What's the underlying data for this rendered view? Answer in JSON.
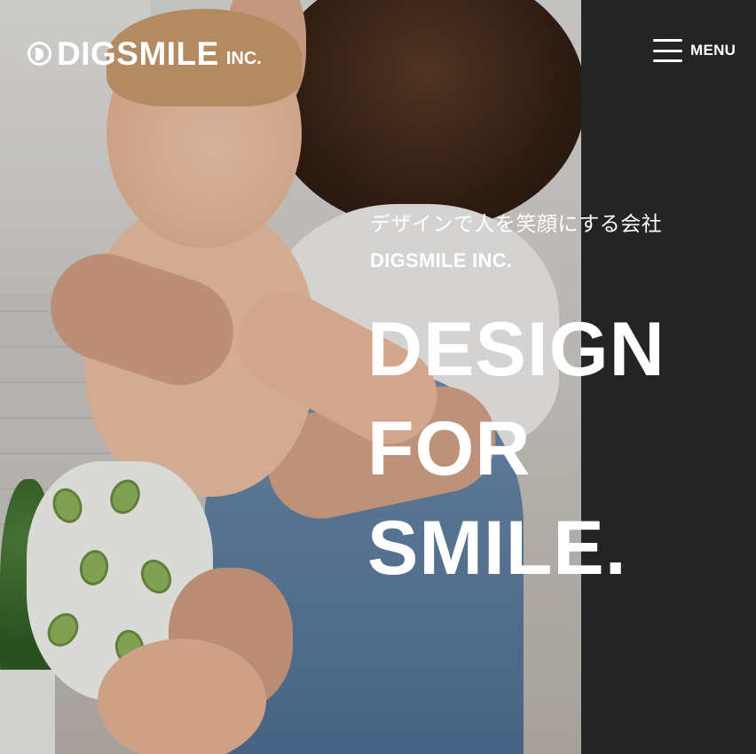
{
  "header": {
    "logo_text": "DIGSMILE",
    "logo_sub": "INC.",
    "menu_label": "MENU"
  },
  "hero": {
    "tagline_jp": "デザインで人を笑顔にする会社",
    "tagline_en": "DIGSMILE INC.",
    "headline": [
      "DESIGN",
      "FOR",
      "SMILE."
    ]
  },
  "colors": {
    "dark_panel": "#242424",
    "text": "#ffffff"
  },
  "icons": {
    "logo_mark": "circle-d-logo-icon",
    "menu": "hamburger-icon"
  }
}
